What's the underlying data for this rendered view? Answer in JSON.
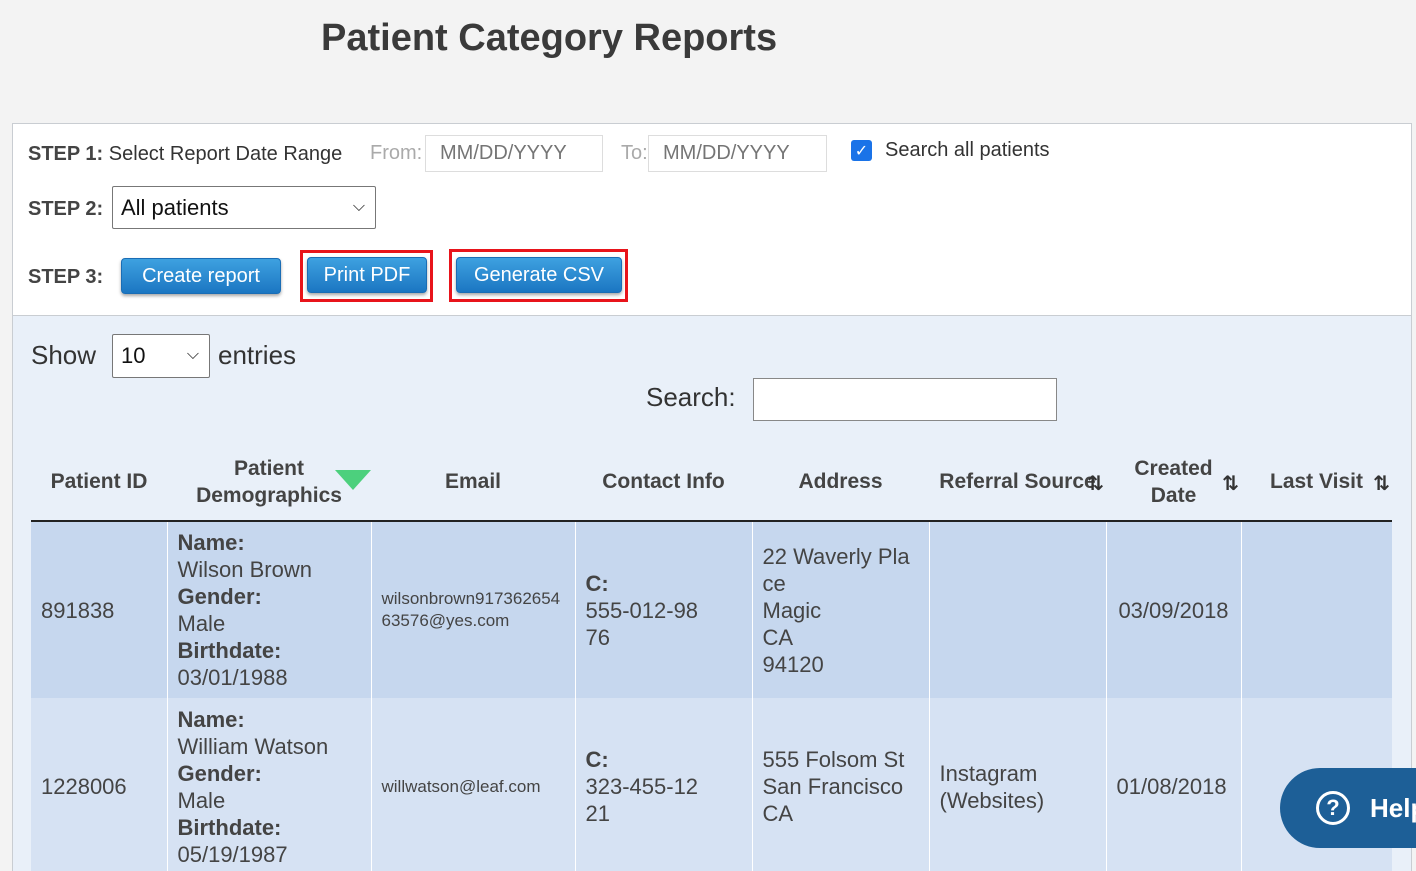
{
  "page_title": "Patient Category Reports",
  "step1": {
    "label": "STEP 1:",
    "text": "Select Report Date Range",
    "from_label": "From:",
    "from_placeholder": "MM/DD/YYYY",
    "to_label": "To:",
    "to_placeholder": "MM/DD/YYYY",
    "checkbox_label": "Search all patients",
    "checkbox_checked": true
  },
  "step2": {
    "label": "STEP 2:",
    "selected": "All patients"
  },
  "step3": {
    "label": "STEP 3:",
    "create_label": "Create report",
    "pdf_label": "Print PDF",
    "csv_label": "Generate CSV"
  },
  "table_controls": {
    "show_label": "Show",
    "entries_value": "10",
    "entries_label": "entries",
    "search_label": "Search:"
  },
  "columns": [
    "Patient ID",
    "Patient Demographics",
    "Email",
    "Contact Info",
    "Address",
    "Referral Source",
    "Created Date",
    "Last Visit"
  ],
  "rows": [
    {
      "id": "891838",
      "name_label": "Name:",
      "name": "Wilson Brown",
      "gender_label": "Gender:",
      "gender": "Male",
      "birth_label": "Birthdate:",
      "birthdate": "03/01/1988",
      "email": "wilsonbrown91736265463576@yes.com",
      "contact_label": "C:",
      "contact": "555-012-9876",
      "address1": "22 Waverly Place",
      "address2": "Magic",
      "address3": "CA",
      "address4": "94120",
      "referral": "",
      "created": "03/09/2018",
      "last_visit": ""
    },
    {
      "id": "1228006",
      "name_label": "Name:",
      "name": "William Watson",
      "gender_label": "Gender:",
      "gender": "Male",
      "birth_label": "Birthdate:",
      "birthdate": "05/19/1987",
      "email": "willwatson@leaf.com",
      "contact_label": "C:",
      "contact": "323-455-1221",
      "address1": "555 Folsom St",
      "address2": "San Francisco",
      "address3": "CA",
      "address4": "",
      "referral": "Instagram (Websites)",
      "created": "01/08/2018",
      "last_visit": ""
    }
  ],
  "help_label": "Help",
  "colors": {
    "button": "#2185d0",
    "highlight": "#e8141b",
    "row1": "#c6d7ee",
    "row2": "#d6e2f3",
    "help": "#1d5f97"
  }
}
